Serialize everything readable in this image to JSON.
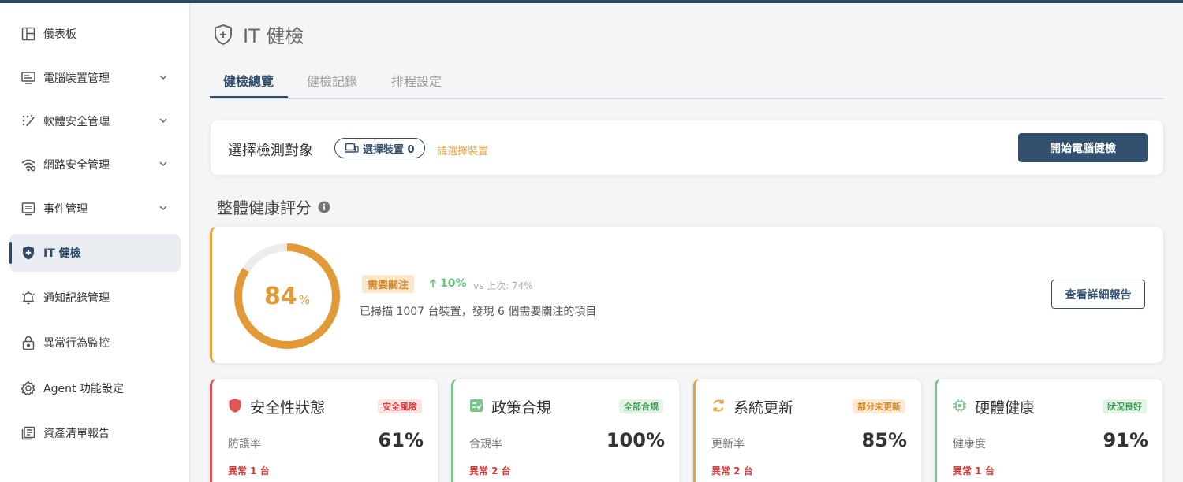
{
  "sidebar": {
    "items": [
      {
        "label": "儀表板",
        "icon": "dashboard-icon"
      },
      {
        "label": "電腦裝置管理",
        "icon": "computer-icon"
      },
      {
        "label": "軟體安全管理",
        "icon": "magic-icon"
      },
      {
        "label": "網路安全管理",
        "icon": "wifi-icon"
      },
      {
        "label": "事件管理",
        "icon": "event-list-icon"
      },
      {
        "label": "IT 健檢",
        "icon": "shield-plus-icon"
      },
      {
        "label": "通知記錄管理",
        "icon": "bell-icon"
      },
      {
        "label": "異常行為監控",
        "icon": "lock-icon"
      },
      {
        "label": "Agent 功能設定",
        "icon": "gear-icon"
      },
      {
        "label": "資產清單報告",
        "icon": "report-icon"
      }
    ]
  },
  "page": {
    "title": "IT 健檢"
  },
  "tabs": [
    {
      "label": "健檢總覽",
      "active": true
    },
    {
      "label": "健檢記錄",
      "active": false
    },
    {
      "label": "排程設定",
      "active": false
    }
  ],
  "target": {
    "label": "選擇檢測對象",
    "device_button": "選擇裝置 0",
    "hint": "請選擇裝置",
    "start_button": "開始電腦健檢"
  },
  "score_section": {
    "title": "整體健康評分"
  },
  "score": {
    "value": 84,
    "value_text": "84",
    "unit": "%",
    "status_badge": "需要關注",
    "delta": "10%",
    "vs_text": "vs 上次: 74%",
    "summary": "已掃描 1007 台裝置，發現 6 個需要關注的項目",
    "report_button": "查看詳細報告",
    "color": "#e29a39"
  },
  "metrics": [
    {
      "title": "安全性狀態",
      "badge": "安全風險",
      "label": "防護率",
      "value": "61%",
      "alert": "異常 1 台",
      "color": "#e05555",
      "badge_bg": "#fde3e3",
      "badge_fg": "#d43a3a",
      "icon": "shield-icon"
    },
    {
      "title": "政策合規",
      "badge": "全部合規",
      "label": "合規率",
      "value": "100%",
      "alert": "異常 2 台",
      "color": "#7cc28b",
      "badge_bg": "#e3f4e6",
      "badge_fg": "#3f9b55",
      "icon": "checklist-icon"
    },
    {
      "title": "系統更新",
      "badge": "部分未更新",
      "label": "更新率",
      "value": "85%",
      "alert": "異常 2 台",
      "color": "#e8a23c",
      "badge_bg": "#fcebd2",
      "badge_fg": "#d2892a",
      "icon": "refresh-icon"
    },
    {
      "title": "硬體健康",
      "badge": "狀況良好",
      "label": "健康度",
      "value": "91%",
      "alert": "異常 1 台",
      "color": "#7cc28b",
      "badge_bg": "#e3f4e6",
      "badge_fg": "#3f9b55",
      "icon": "chip-icon"
    }
  ]
}
